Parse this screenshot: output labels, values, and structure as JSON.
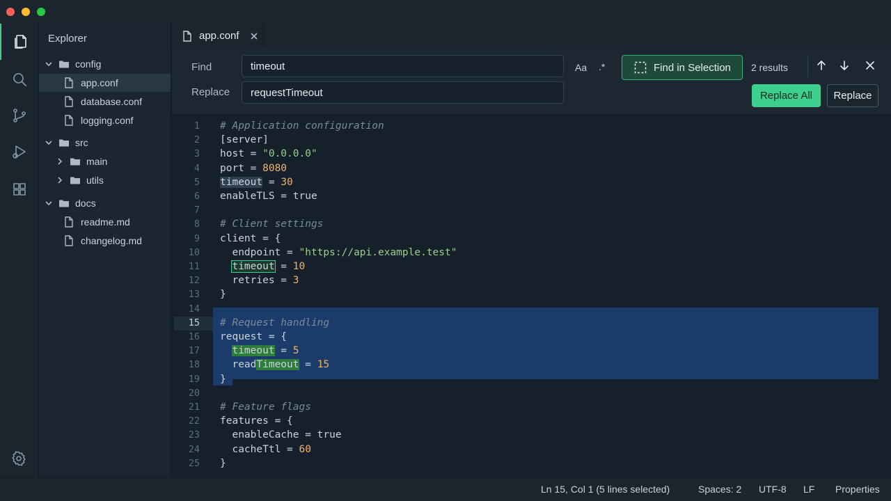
{
  "sidebar": {
    "title": "Explorer",
    "tree": [
      {
        "type": "folder",
        "label": "config",
        "depth": 0,
        "expanded": true
      },
      {
        "type": "file",
        "label": "app.conf",
        "depth": 1,
        "selected": true
      },
      {
        "type": "file",
        "label": "database.conf",
        "depth": 1
      },
      {
        "type": "file",
        "label": "logging.conf",
        "depth": 1
      },
      {
        "type": "folder",
        "label": "src",
        "depth": 0,
        "expanded": true
      },
      {
        "type": "folder",
        "label": "main",
        "depth": 1,
        "expanded": false
      },
      {
        "type": "folder",
        "label": "utils",
        "depth": 1,
        "expanded": false
      },
      {
        "type": "folder",
        "label": "docs",
        "depth": 0,
        "expanded": true
      },
      {
        "type": "file",
        "label": "readme.md",
        "depth": 1
      },
      {
        "type": "file",
        "label": "changelog.md",
        "depth": 1
      }
    ]
  },
  "activity": [
    "files-icon",
    "search-icon",
    "source-control-icon",
    "run-debug-icon",
    "extensions-icon",
    "gear-icon"
  ],
  "tabs": [
    {
      "label": "app.conf",
      "icon": "file-icon"
    }
  ],
  "find": {
    "find_label": "Find",
    "find_value": "timeout",
    "replace_label": "Replace",
    "replace_value": "requestTimeout",
    "match_case": "Aa",
    "regex": ".*",
    "find_in_selection": "Find in Selection",
    "results": "2 results",
    "replace_all": "Replace All",
    "replace": "Replace"
  },
  "editor": {
    "lines": [
      {
        "n": "1",
        "text": "# Application configuration"
      },
      {
        "n": "2",
        "text": "[server]"
      },
      {
        "n": "3",
        "text": "host = \"0.0.0.0\""
      },
      {
        "n": "4",
        "text": "port = 8080"
      },
      {
        "n": "5",
        "text": "timeout = 30"
      },
      {
        "n": "6",
        "text": "enableTLS = true"
      },
      {
        "n": "7",
        "text": ""
      },
      {
        "n": "8",
        "text": "# Client settings"
      },
      {
        "n": "9",
        "text": "client = {"
      },
      {
        "n": "10",
        "text": "  endpoint = \"https://api.example.test\""
      },
      {
        "n": "11",
        "text": "  timeout = 10"
      },
      {
        "n": "12",
        "text": "  retries = 3"
      },
      {
        "n": "13",
        "text": "}"
      },
      {
        "n": "14",
        "text": ""
      },
      {
        "n": "15",
        "text": "# Request handling"
      },
      {
        "n": "16",
        "text": "request = {"
      },
      {
        "n": "17",
        "text": "  timeout = 5"
      },
      {
        "n": "18",
        "text": "  readTimeout = 15"
      },
      {
        "n": "19",
        "text": "}"
      },
      {
        "n": "20",
        "text": ""
      },
      {
        "n": "21",
        "text": "# Feature flags"
      },
      {
        "n": "22",
        "text": "features = {"
      },
      {
        "n": "23",
        "text": "  enableCache = true"
      },
      {
        "n": "24",
        "text": "  cacheTtl = 60"
      },
      {
        "n": "25",
        "text": "}"
      }
    ]
  },
  "status": {
    "position": "Ln 15, Col 1 (5 lines selected)",
    "spaces": "Spaces: 2",
    "encoding": "UTF-8",
    "eol": "LF",
    "properties": "Properties"
  },
  "colors": {
    "accent": "#3ecf8e",
    "selection": "#1b3c6a",
    "background": "#16202a"
  }
}
